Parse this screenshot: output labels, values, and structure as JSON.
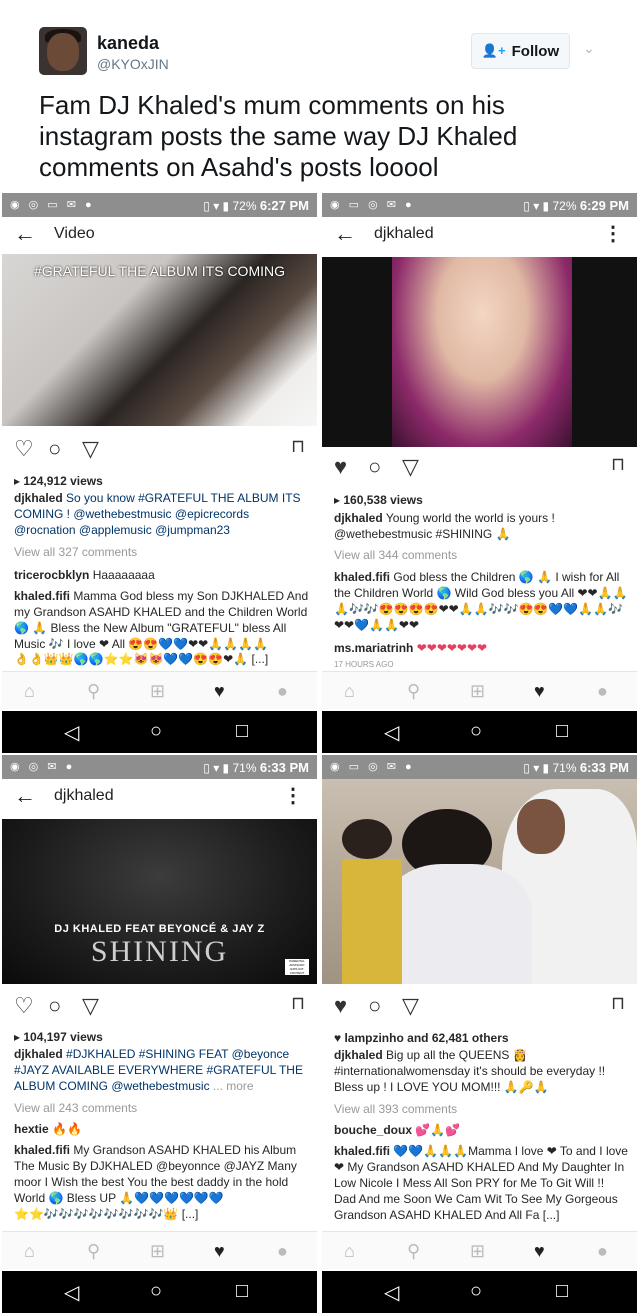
{
  "tweet": {
    "name": "kaneda",
    "handle": "@KYOxJIN",
    "follow_label": "Follow",
    "text": "Fam  DJ Khaled's mum comments on his instagram posts the same way DJ Khaled comments on Asahd's posts looool"
  },
  "panels": [
    {
      "status_time": "6:27 PM",
      "status_battery": "72%",
      "title": "Video",
      "overlay": "#GRATEFUL THE ALBUM ITS COMING",
      "views": "124,912 views",
      "caption_user": "djkhaled",
      "caption": "So you know #GRATEFUL THE ALBUM ITS COMING ! @wethebestmusic @epicrecords @rocnation @applemusic @jumpman23",
      "view_all": "View all 327 comments",
      "c1_user": "tricerocbklyn",
      "c1_text": "Haaaaaaaa",
      "c2_user": "khaled.fifi",
      "c2_text": "Mamma God bless my Son DJKHALED And my Grandson ASAHD KHALED and  the Children World 🌎 🙏 Bless the New Album \"GRATEFUL\" bless All Music 🎶 I love ❤ All 😍😍💙💙❤❤🙏🙏🙏🙏",
      "c2_tail": "👌👌👑👑🌎🌎⭐⭐😻😻💙💙😍😍❤🙏 [...]"
    },
    {
      "status_time": "6:29 PM",
      "status_battery": "72%",
      "title": "djkhaled",
      "views": "160,538 views",
      "caption_user": "djkhaled",
      "caption": "Young world the world is yours ! @wethebestmusic #SHINING 🙏",
      "view_all": "View all 344 comments",
      "c1_user": "khaled.fifi",
      "c1_text": "God bless the Children 🌎 🙏 I wish for All the Children World 🌎 Wild God bless you All ❤❤🙏🙏🙏🎶🎶😍😍😍😍❤❤🙏🙏🎶🎶😍😍💙💙🙏🙏🎶❤❤💙🙏🙏❤❤",
      "c2_user": "ms.mariatrinh",
      "c2_text": "❤❤❤❤❤❤❤",
      "time_ago": "17 HOURS AGO"
    },
    {
      "status_time": "6:33 PM",
      "status_battery": "71%",
      "title": "djkhaled",
      "album_artist": "DJ KHALED FEAT BEYONCÉ & JAY Z",
      "album_title": "SHINING",
      "advisory": "PARENTAL ADVISORY EXPLICIT CONTENT",
      "views": "104,197 views",
      "caption_user": "djkhaled",
      "caption": "#DJKHALED #SHINING FEAT @beyonce #JAYZ AVAILABLE EVERYWHERE #GRATEFUL THE ALBUM COMING @wethebestmusic",
      "more": "... more",
      "view_all": "View all 243 comments",
      "c1_user": "hextie",
      "c1_text": "🔥🔥",
      "c2_user": "khaled.fifi",
      "c2_text": "My Grandson ASAHD KHALED his Album The Music By DJKHALED @beyonnce @JAYZ Many moor I Wish the best You the best daddy in the hold World 🌎 Bless UP 🙏💙💙💙💙💙💙",
      "c2_tail": "⭐⭐🎶🎶🎶🎶🎶🎶🎶🎶👑 [...]"
    },
    {
      "status_time": "6:33 PM",
      "status_battery": "71%",
      "likes_user": "lampzinho",
      "likes_rest": "and 62,481 others",
      "caption_user": "djkhaled",
      "caption": "Big up all the QUEENS 👸 #internationalwomensday it's should be everyday !! Bless up ! I LOVE YOU MOM!!! 🙏🔑🙏",
      "view_all": "View all 393 comments",
      "c1_user": "bouche_doux",
      "c1_text": "💕🙏💕",
      "c2_user": "khaled.fifi",
      "c2_text": "💙💙🙏🙏🙏Mamma I love ❤ To and I love ❤ My Grandson ASAHD KHALED And My Daughter In Low Nicole I Mess All Son PRY for Me To Git Will !! Dad And me Soon We Cam Wit To See My Gorgeous  Grandson ASAHD KHALED And All Fa [...]"
    }
  ],
  "colors": {
    "status": "#8e8e8e",
    "heart": "#e4405f",
    "link": "#003569",
    "twitter_blue": "#1da1f2"
  },
  "icons": [
    "heart-icon",
    "comment-icon",
    "send-icon",
    "bookmark-icon",
    "home-icon",
    "search-icon",
    "plus-icon",
    "activity-icon",
    "profile-icon",
    "back-icon",
    "more-icon"
  ]
}
